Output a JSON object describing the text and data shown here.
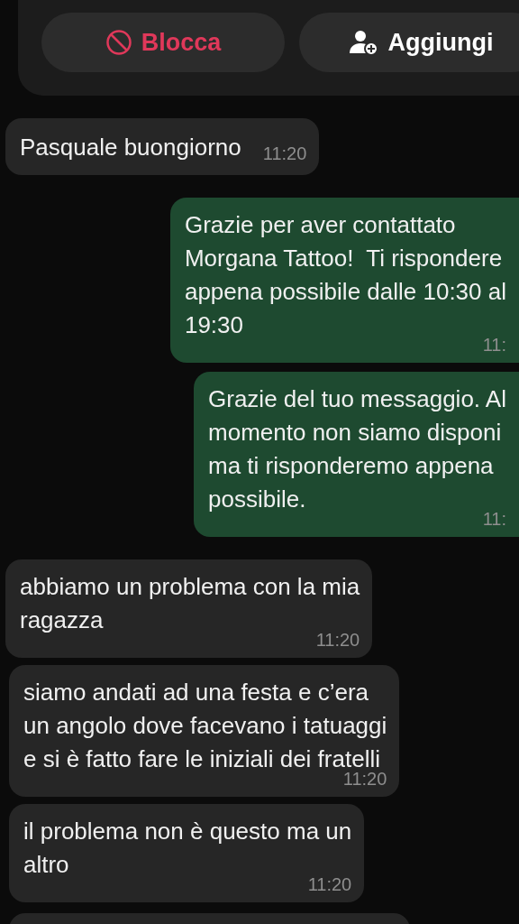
{
  "actions": [
    {
      "kind": "block",
      "label": "Blocca"
    },
    {
      "kind": "add",
      "label": "Aggiungi"
    }
  ],
  "messages": [
    {
      "kind": "incoming",
      "text": "Pasquale buongiorno",
      "time": "11:20"
    },
    {
      "kind": "outgoing",
      "text": "Grazie per aver contattato\nMorgana Tattoo!  Ti rispondere\nappena possibile dalle 10:30 al\n19:30",
      "time": "11:"
    },
    {
      "kind": "outgoing",
      "text": "Grazie del tuo messaggio. Al\nmomento non siamo disponi\nma ti risponderemo appena\npossibile.",
      "time": "11:"
    },
    {
      "kind": "incoming",
      "text": "abbiamo un problema con la mia\nragazza",
      "time": "11:20"
    },
    {
      "kind": "incoming",
      "text": "siamo andati ad una festa e c’era\nun angolo dove facevano i tatuaggi\ne si è fatto fare le iniziali dei fratelli",
      "time": "11:20"
    },
    {
      "kind": "incoming",
      "text": "il problema non è questo ma un\naltro",
      "time": "11:20"
    }
  ]
}
